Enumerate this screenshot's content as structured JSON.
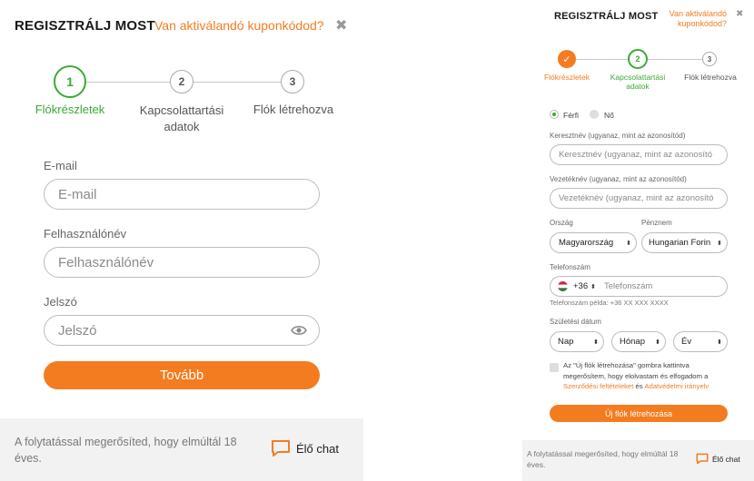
{
  "left": {
    "title": "REGISZTRÁLJ MOST",
    "coupon_link": "Van aktiválandó kuponkódod?",
    "close_glyph": "✖",
    "steps": [
      {
        "num": "1",
        "label": "Flókrészletek"
      },
      {
        "num": "2",
        "label": "Kapcsolattartási adatok"
      },
      {
        "num": "3",
        "label": "Flók létrehozva"
      }
    ],
    "email_label": "E-mail",
    "email_placeholder": "E-mail",
    "username_label": "Felhasználónév",
    "username_placeholder": "Felhasználónév",
    "password_label": "Jelszó",
    "password_placeholder": "Jelszó",
    "next_button": "Tovább",
    "footer_text": "A folytatással megerősíted, hogy elmúltál 18 éves.",
    "chat_label": "Élő chat"
  },
  "right": {
    "title": "REGISZTRÁLJ MOST",
    "coupon_link": "Van aktiválandó kuponkódod?",
    "close_glyph": "✖",
    "steps": [
      {
        "num": "✓",
        "label": "Flókrészletek"
      },
      {
        "num": "2",
        "label": "Kapcsolattartási adatok"
      },
      {
        "num": "3",
        "label": "Flók létrehozva"
      }
    ],
    "gender_male": "Férfi",
    "gender_female": "Nő",
    "firstname_label": "Keresztnév (ugyanaz, mint az azonosítód)",
    "firstname_placeholder": "Keresztnév (ugyanaz, mint az azonosító",
    "lastname_label": "Vezetéknév (ugyanaz, mint az azonosítód)",
    "lastname_placeholder": "Vezetéknév (ugyanaz, mint az azonosító",
    "country_label": "Ország",
    "country_value": "Magyarország",
    "currency_label": "Pénznem",
    "currency_value": "Hungarian Forin",
    "phone_label": "Telefonszám",
    "phone_prefix": "+36",
    "phone_placeholder": "Telefonszám",
    "phone_example": "Telefonszám példa: +36 XX XXX XXXX",
    "dob_label": "Születési dátum",
    "day": "Nap",
    "month": "Hónap",
    "year": "Év",
    "terms_part1": "Az \"Új flók létrehozása\" gombra kattintva megerősítem, hogy elolvastam és elfogadom a",
    "terms_link1": "Szerződési feltételeket",
    "terms_and": "és",
    "terms_link2": "Adatvédelmi irányelv",
    "create_button": "Új flók létrehozása",
    "footer_text": "A folytatással megerősíted, hogy elmúltál 18 éves.",
    "chat_label": "Élő chat"
  },
  "colors": {
    "accent": "#f47c20",
    "active_step": "#3aaa35",
    "inactive_step": "#c8c8c8"
  }
}
